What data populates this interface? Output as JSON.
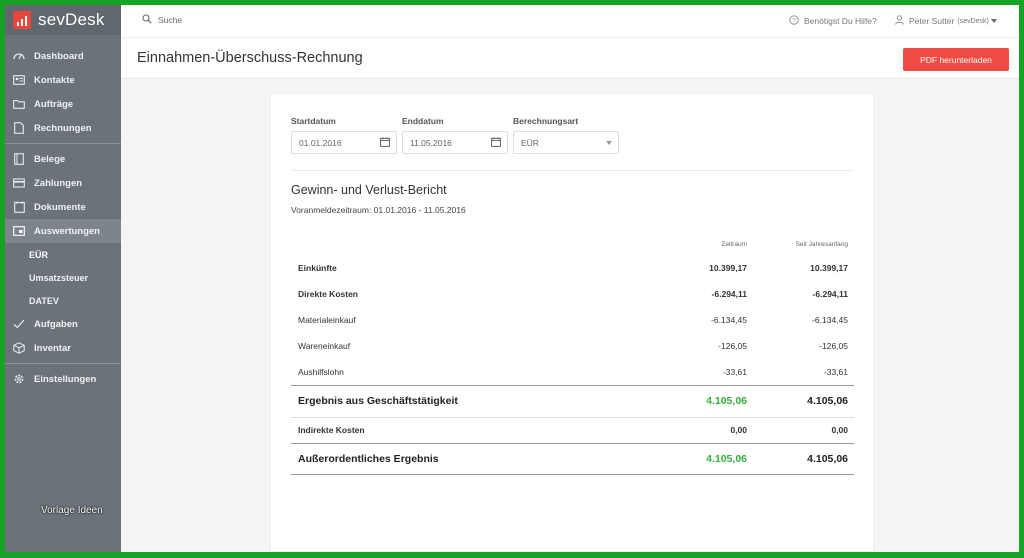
{
  "app": {
    "name": "sevDesk"
  },
  "sidebar": {
    "items": [
      {
        "label": "Dashboard",
        "icon": "dashboard-icon"
      },
      {
        "label": "Kontakte",
        "icon": "contacts-icon"
      },
      {
        "label": "Aufträge",
        "icon": "folder-icon"
      },
      {
        "label": "Rechnungen",
        "icon": "invoice-icon"
      },
      {
        "label": "Belege",
        "icon": "receipt-icon"
      },
      {
        "label": "Zahlungen",
        "icon": "card-icon"
      },
      {
        "label": "Dokumente",
        "icon": "documents-icon"
      },
      {
        "label": "Auswertungen",
        "icon": "reports-icon"
      },
      {
        "label": "Aufgaben",
        "icon": "check-icon"
      },
      {
        "label": "Inventar",
        "icon": "box-icon"
      },
      {
        "label": "Einstellungen",
        "icon": "gear-icon"
      }
    ],
    "subitems": [
      {
        "label": "EÜR"
      },
      {
        "label": "Umsatzsteuer"
      },
      {
        "label": "DATEV"
      }
    ]
  },
  "watermark": "Vorlage Ideen",
  "topbar": {
    "search_label": "Suche",
    "help_label": "Benötigst Du Hilfe?",
    "user_name": "Peter Sutter",
    "user_org": "(sevDesk)"
  },
  "page": {
    "title": "Einnahmen-Überschuss-Rechnung",
    "pdf_button": "PDF herunterladen"
  },
  "filters": {
    "start_label": "Startdatum",
    "start_value": "01.01.2016",
    "end_label": "Enddatum",
    "end_value": "11.05.2016",
    "calc_label": "Berechnungsart",
    "calc_value": "EÜR"
  },
  "report": {
    "title": "Gewinn- und Verlust-Bericht",
    "period": "Voranmeldezeitraum: 01.01.2016 - 11.05.2016",
    "col_period": "Zeitraum",
    "col_ytd": "Seit Jahresanfang",
    "rows": [
      {
        "label": "Einkünfte",
        "period": "10.399,17",
        "ytd": "10.399,17"
      },
      {
        "label": "Direkte Kosten",
        "period": "-6.294,11",
        "ytd": "-6.294,11"
      },
      {
        "label": "Materialeinkauf",
        "period": "-6.134,45",
        "ytd": "-6.134,45"
      },
      {
        "label": "Wareneinkauf",
        "period": "-126,05",
        "ytd": "-126,05"
      },
      {
        "label": "Aushilfslohn",
        "period": "-33,61",
        "ytd": "-33,61"
      },
      {
        "label": "Ergebnis aus Geschäftstätigkeit",
        "period": "4.105,06",
        "ytd": "4.105,06"
      },
      {
        "label": "Indirekte Kosten",
        "period": "0,00",
        "ytd": "0,00"
      },
      {
        "label": "Außerordentliches Ergebnis",
        "period": "4.105,06",
        "ytd": "4.105,06"
      }
    ]
  },
  "colors": {
    "accent": "#ee4c42",
    "positive": "#33b03c",
    "sidebar": "#6b727a",
    "frame": "#16a325"
  }
}
